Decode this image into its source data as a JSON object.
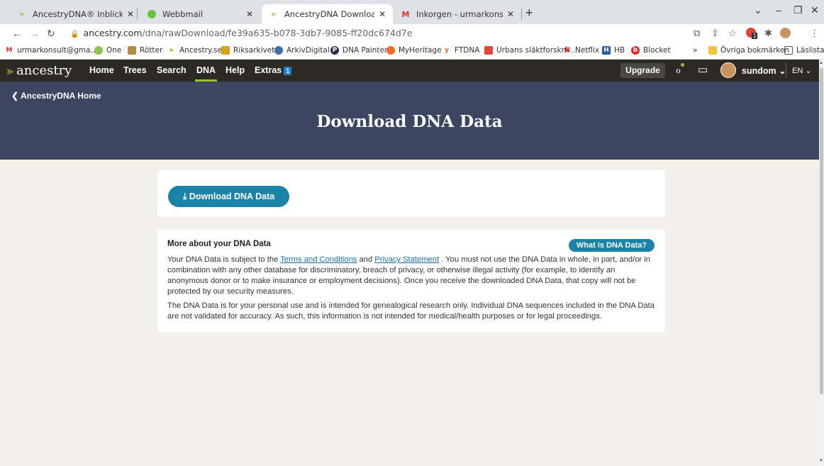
{
  "browser": {
    "tabs": [
      {
        "title": "AncestryDNA® Inblick"
      },
      {
        "title": "Webbmail"
      },
      {
        "title": "AncestryDNA Download"
      },
      {
        "title": "Inkorgen - urmarkonsult@gmail."
      }
    ],
    "url_host": "ancestry.com",
    "url_path": "/dna/rawDownload/fe39a635-b078-3db7-9085-ff20dc674d7e",
    "bookmarks": [
      "urmarkonsult@gma...",
      "One",
      "Rötter",
      "Ancestry.se",
      "Riksarkivet",
      "ArkivDigital",
      "DNA Painter",
      "MyHeritage",
      "FTDNA",
      "Urbans släktforskni...",
      "Netflix",
      "HB",
      "Blocket",
      "»",
      "Övriga bokmärken",
      "Läslista"
    ],
    "extension_badge": "1"
  },
  "nav": {
    "logo": "ancestry",
    "links": [
      "Home",
      "Trees",
      "Search",
      "DNA",
      "Help",
      "Extras"
    ],
    "extras_badge": "1",
    "upgrade": "Upgrade",
    "user": "sundom ⌄",
    "lang": "EN ⌄"
  },
  "header": {
    "back_link": "AncestryDNA Home",
    "title": "Download DNA Data"
  },
  "download": {
    "button": "Download DNA Data"
  },
  "more": {
    "title": "More about your DNA Data",
    "what_button": "What is DNA Data?",
    "p1_a": "Your DNA Data is subject to the ",
    "terms_link": "Terms and Conditions",
    "p1_b": " and ",
    "privacy_link": "Privacy Statement",
    "p1_c": " . You must not use the DNA Data in whole, in part, and/or in combination with any other database for discriminatory, breach of privacy, or otherwise illegal activity (for example, to identify an anonymous donor or to make insurance or employment decisions). Once you receive the downloaded DNA Data, that copy will not be protected by our security measures.",
    "p2": "The DNA Data is for your personal use and is intended for genealogical research only. Individual DNA sequences included in the DNA Data are not validated for accuracy. As such, this information is not intended for medical/health purposes or for legal proceedings."
  },
  "colors": {
    "nav_bg": "#2d2a26",
    "hero_bg": "#3c4661",
    "accent_green": "#9cbe30",
    "button_blue": "#1b82a8",
    "page_bg": "#f3f0ec"
  }
}
